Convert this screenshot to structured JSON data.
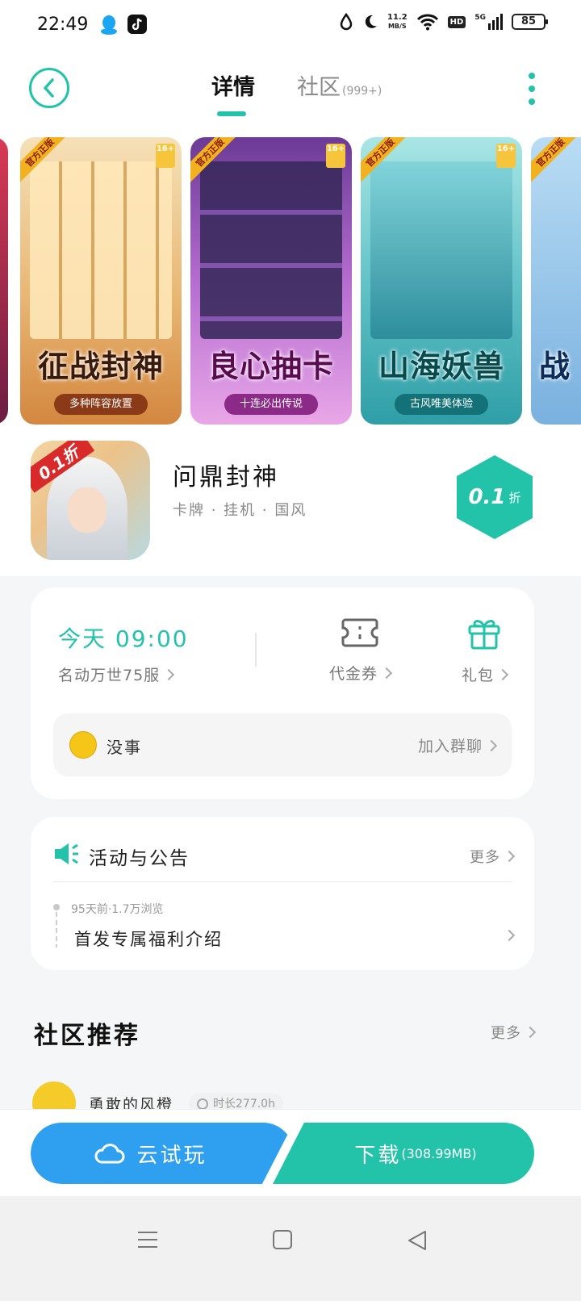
{
  "status_bar": {
    "time": "22:49",
    "speed_value": "11.2",
    "speed_unit": "MB/S",
    "hd": "HD",
    "network": "5G",
    "battery": "85"
  },
  "header": {
    "tabs": [
      {
        "label": "详情",
        "active": true
      },
      {
        "label": "社区",
        "count": "(999+)",
        "active": false
      }
    ]
  },
  "banner": {
    "screenshots": [
      {
        "badge": "官方正版",
        "age": "16+",
        "title": "征战封神",
        "subtitle": "多种阵容放置"
      },
      {
        "badge": "官方正版",
        "age": "16+",
        "title": "良心抽卡",
        "subtitle": "十连必出传说"
      },
      {
        "badge": "官方正版",
        "age": "16+",
        "title": "山海妖兽",
        "subtitle": "古风唯美体验"
      },
      {
        "badge": "官方正版",
        "title": "战"
      }
    ]
  },
  "app": {
    "icon_badge": "0.1折",
    "name": "问鼎封神",
    "tags": "卡牌 · 挂机 · 国风",
    "discount_value": "0.1",
    "discount_unit": "折"
  },
  "info_card": {
    "open_time": "今天 09:00",
    "server_name": "名动万世75服",
    "voucher_label": "代金券",
    "gift_label": "礼包",
    "group_name": "没事",
    "group_join": "加入群聊"
  },
  "announcements": {
    "title": "活动与公告",
    "more": "更多",
    "items": [
      {
        "meta": "95天前·1.7万浏览",
        "title": "首发专属福利介绍"
      }
    ]
  },
  "community": {
    "title": "社区推荐",
    "more": "更多",
    "post": {
      "user": "勇敢的风橙",
      "badge": "时长277.0h"
    }
  },
  "actions": {
    "cloud_play": "云试玩",
    "download": "下载",
    "download_size": "(308.99MB)"
  },
  "colors": {
    "accent": "#22c3a8",
    "cloud_button": "#2ea0ef"
  }
}
